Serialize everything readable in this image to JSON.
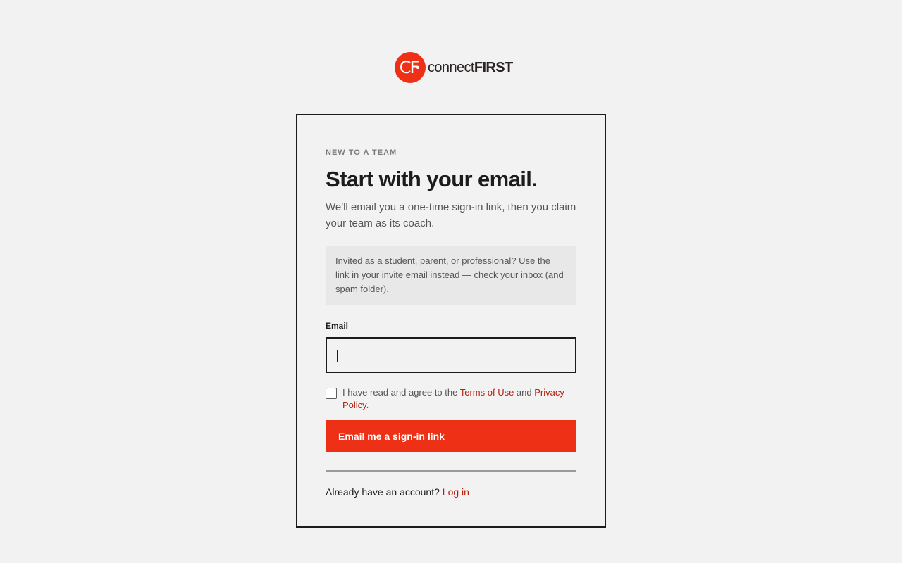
{
  "brand": {
    "mark_text": "CF",
    "word_regular": "connect",
    "word_bold": "FIRST",
    "color": "#ee3017"
  },
  "card": {
    "eyebrow": "NEW TO A TEAM",
    "title": "Start with your email.",
    "subtitle": "We'll email you a one-time sign-in link, then you claim your team as its coach.",
    "notice": "Invited as a student, parent, or professional? Use the link in your invite email instead — check your inbox (and spam folder).",
    "email": {
      "label": "Email",
      "value": "",
      "placeholder": ""
    },
    "agree": {
      "checked": false,
      "prefix": "I have read and agree to the ",
      "terms_link": "Terms of Use",
      "middle": " and ",
      "privacy_link": "Privacy Policy",
      "suffix": "."
    },
    "submit_label": "Email me a sign-in link",
    "login": {
      "prompt": "Already have an account? ",
      "link": "Log in"
    }
  },
  "colors": {
    "accent": "#ee3017",
    "link": "#b5200d",
    "background": "#f2f2f2",
    "text": "#1c1c1c"
  }
}
